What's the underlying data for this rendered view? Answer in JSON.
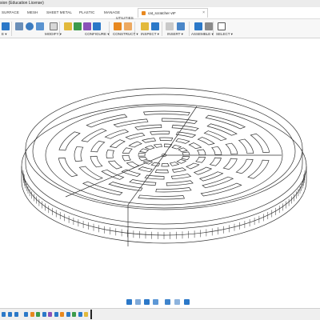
{
  "window": {
    "title": "sion (Education License)"
  },
  "ribbon": {
    "tabs": [
      {
        "label": "SURFACE"
      },
      {
        "label": "MESH"
      },
      {
        "label": "SHEET METAL"
      },
      {
        "label": "PLASTIC"
      },
      {
        "label": "MANAGE"
      },
      {
        "label": "UTILITIES"
      }
    ],
    "groups": [
      {
        "label": "E ▾"
      },
      {
        "label": "MODIFY ▾"
      },
      {
        "label": "CONFIGURE ▾"
      },
      {
        "label": "CONSTRUCT ▾"
      },
      {
        "label": "INSPECT ▾"
      },
      {
        "label": "INSERT ▾"
      },
      {
        "label": "ASSEMBLE ▾"
      },
      {
        "label": "SELECT ▾"
      }
    ]
  },
  "document": {
    "tab_label": "cat_scratcher v9*",
    "close_glyph": "×"
  },
  "colors": {
    "accent_blue": "#2b78c8",
    "orange": "#e8881f",
    "green": "#3c9b4b",
    "yellow": "#e2b93b",
    "purple": "#8a52b8",
    "model_stroke": "#333333"
  },
  "icons": {
    "toolbar": [
      "solid-icon",
      "push-pull-icon",
      "fillet-icon",
      "shell-icon",
      "move-icon",
      "configure-icon",
      "plane-icon",
      "measure-icon",
      "insert-icon",
      "image-icon",
      "joint-icon",
      "select-icon"
    ],
    "navigation": [
      "orbit-icon",
      "pan-icon",
      "zoom-icon",
      "fit-icon",
      "display-icon",
      "grid-icon",
      "view-icon"
    ]
  }
}
